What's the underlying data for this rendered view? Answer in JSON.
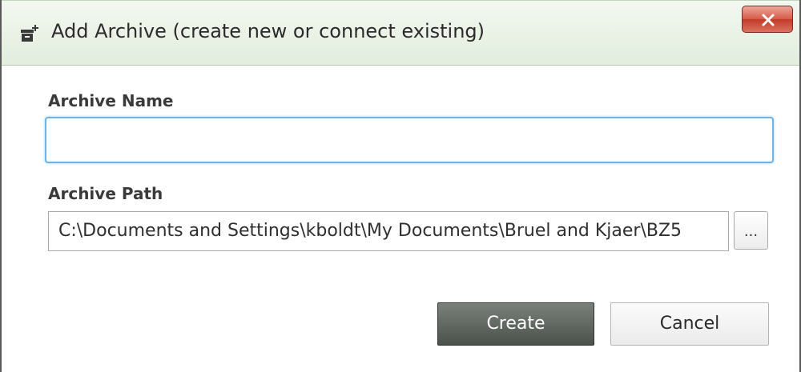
{
  "window": {
    "title": "Add Archive (create new or connect existing)",
    "title_icon": "archive-add-icon",
    "close_icon": "close-icon"
  },
  "form": {
    "name_label": "Archive Name",
    "name_value": "",
    "path_label": "Archive Path",
    "path_value": "C:\\Documents and Settings\\kboldt\\My Documents\\Bruel and Kjaer\\BZ5",
    "browse_label": "..."
  },
  "buttons": {
    "create_label": "Create",
    "cancel_label": "Cancel"
  },
  "colors": {
    "titlebar": "#e2eddd",
    "close_button": "#d65a48",
    "focus_border": "#6fb3e8",
    "create_button": "#5b625c"
  }
}
